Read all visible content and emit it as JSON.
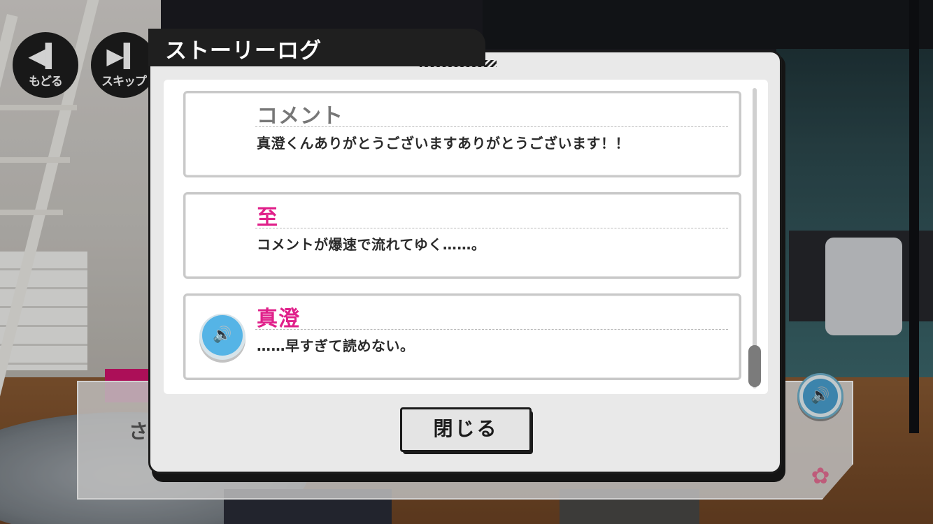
{
  "colors": {
    "speaker_default": "#777777",
    "speaker_highlight": "#e0208a",
    "voice_blue": "#55b4e6",
    "modal_bg": "#e9e9e9",
    "title_bg": "#1f1f1f"
  },
  "top_controls": {
    "back": {
      "icon": "rewind-icon",
      "glyph": "◀︎▍",
      "label": "もどる"
    },
    "skip": {
      "icon": "skip-icon",
      "glyph": "▶︎▍",
      "label": "スキップ"
    }
  },
  "background": {
    "textbox_partial_text": "さ"
  },
  "modal": {
    "title": "ストーリーログ",
    "close_label": "閉じる",
    "entries": [
      {
        "speaker": "コメント",
        "speaker_color": "default",
        "text": "真澄くんありがとうございますありがとうございます！！",
        "has_voice": false
      },
      {
        "speaker": "至",
        "speaker_color": "highlight",
        "text": "コメントが爆速で流れてゆく……。",
        "has_voice": false
      },
      {
        "speaker": "真澄",
        "speaker_color": "highlight",
        "text": "……早すぎて読めない。",
        "has_voice": true,
        "voice_icon": "speaker-icon"
      }
    ]
  },
  "voice_button": {
    "icon": "speaker-icon",
    "glyph": "🔊"
  }
}
